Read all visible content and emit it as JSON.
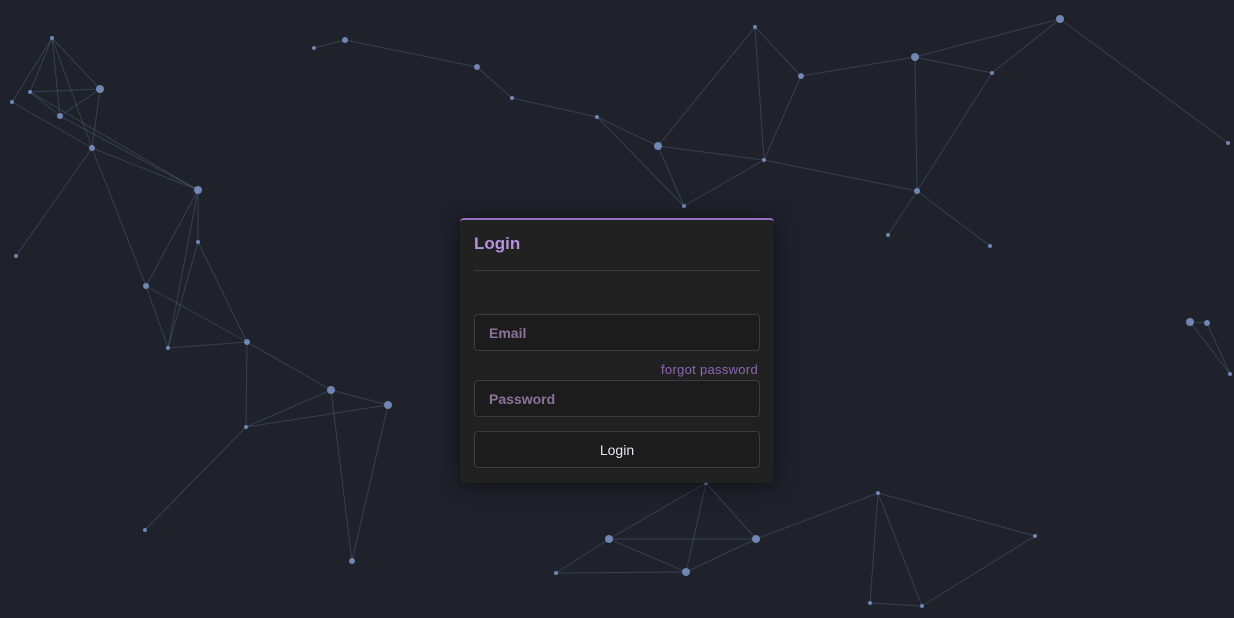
{
  "background": {
    "color": "#1f222b",
    "node_color": "#7d97c8",
    "line_color": "#53637f"
  },
  "login": {
    "title": "Login",
    "accent_color": "#9a6ec4",
    "email_placeholder": "Email",
    "email_value": "",
    "forgot_password_label": "forgot password",
    "password_placeholder": "Password",
    "password_value": "",
    "submit_label": "Login"
  }
}
